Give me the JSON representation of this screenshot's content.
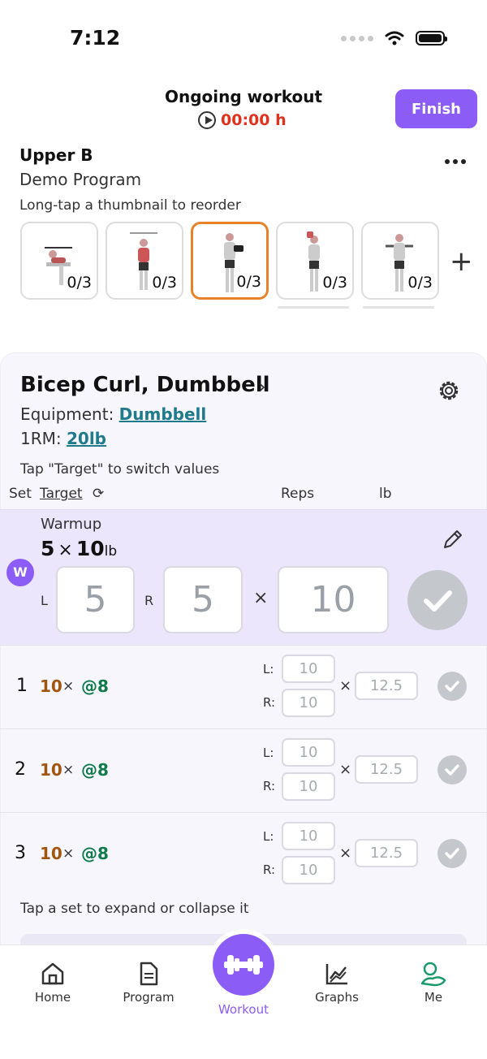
{
  "status": {
    "time": "7:12"
  },
  "header": {
    "title": "Ongoing workout",
    "timer": "00:00 h",
    "finish_label": "Finish"
  },
  "program": {
    "name": "Upper B",
    "subtitle": "Demo Program",
    "reorder_hint": "Long-tap a thumbnail to reorder"
  },
  "thumbnails": [
    {
      "name": "incline-press",
      "progress": "0/3",
      "active": false
    },
    {
      "name": "pull-up",
      "progress": "0/3",
      "active": false
    },
    {
      "name": "bicep-curl",
      "progress": "0/3",
      "active": true
    },
    {
      "name": "triceps-extension",
      "progress": "0/3",
      "active": false
    },
    {
      "name": "lateral-raise",
      "progress": "0/3",
      "active": false
    }
  ],
  "exercise": {
    "title": "Bicep Curl, Dumbbell",
    "equipment_label": "Equipment:",
    "equipment_value": "Dumbbell",
    "orm_label": "1RM:",
    "orm_value": "20lb",
    "switch_hint": "Tap \"Target\" to switch values",
    "columns": {
      "set": "Set",
      "target": "Target",
      "reps": "Reps",
      "unit": "lb"
    }
  },
  "warmup": {
    "label": "Warmup",
    "badge": "W",
    "reps": "5",
    "times": "×",
    "weight": "10",
    "unit": "lb",
    "left_label": "L",
    "right_label": "R",
    "left_reps": "5",
    "right_reps": "5",
    "weight_value": "10"
  },
  "sets": [
    {
      "number": "1",
      "reps": "10",
      "rpe": "@8",
      "left": "10",
      "right": "10",
      "weight": "12.5"
    },
    {
      "number": "2",
      "reps": "10",
      "rpe": "@8",
      "left": "10",
      "right": "10",
      "weight": "12.5"
    },
    {
      "number": "3",
      "reps": "10",
      "rpe": "@8",
      "left": "10",
      "right": "10",
      "weight": "12.5"
    }
  ],
  "set_labels": {
    "left": "L:",
    "right": "R:",
    "times": "×"
  },
  "collapse_hint": "Tap a set to expand or collapse it",
  "nav": {
    "home": "Home",
    "program": "Program",
    "workout": "Workout",
    "graphs": "Graphs",
    "me": "Me"
  },
  "colors": {
    "accent": "#8b5cf6",
    "timer": "#e0301e",
    "reps": "#a0560f",
    "rpe": "#0f7a4a",
    "link": "#1f7a8c",
    "active_thumb": "#e8822a"
  }
}
